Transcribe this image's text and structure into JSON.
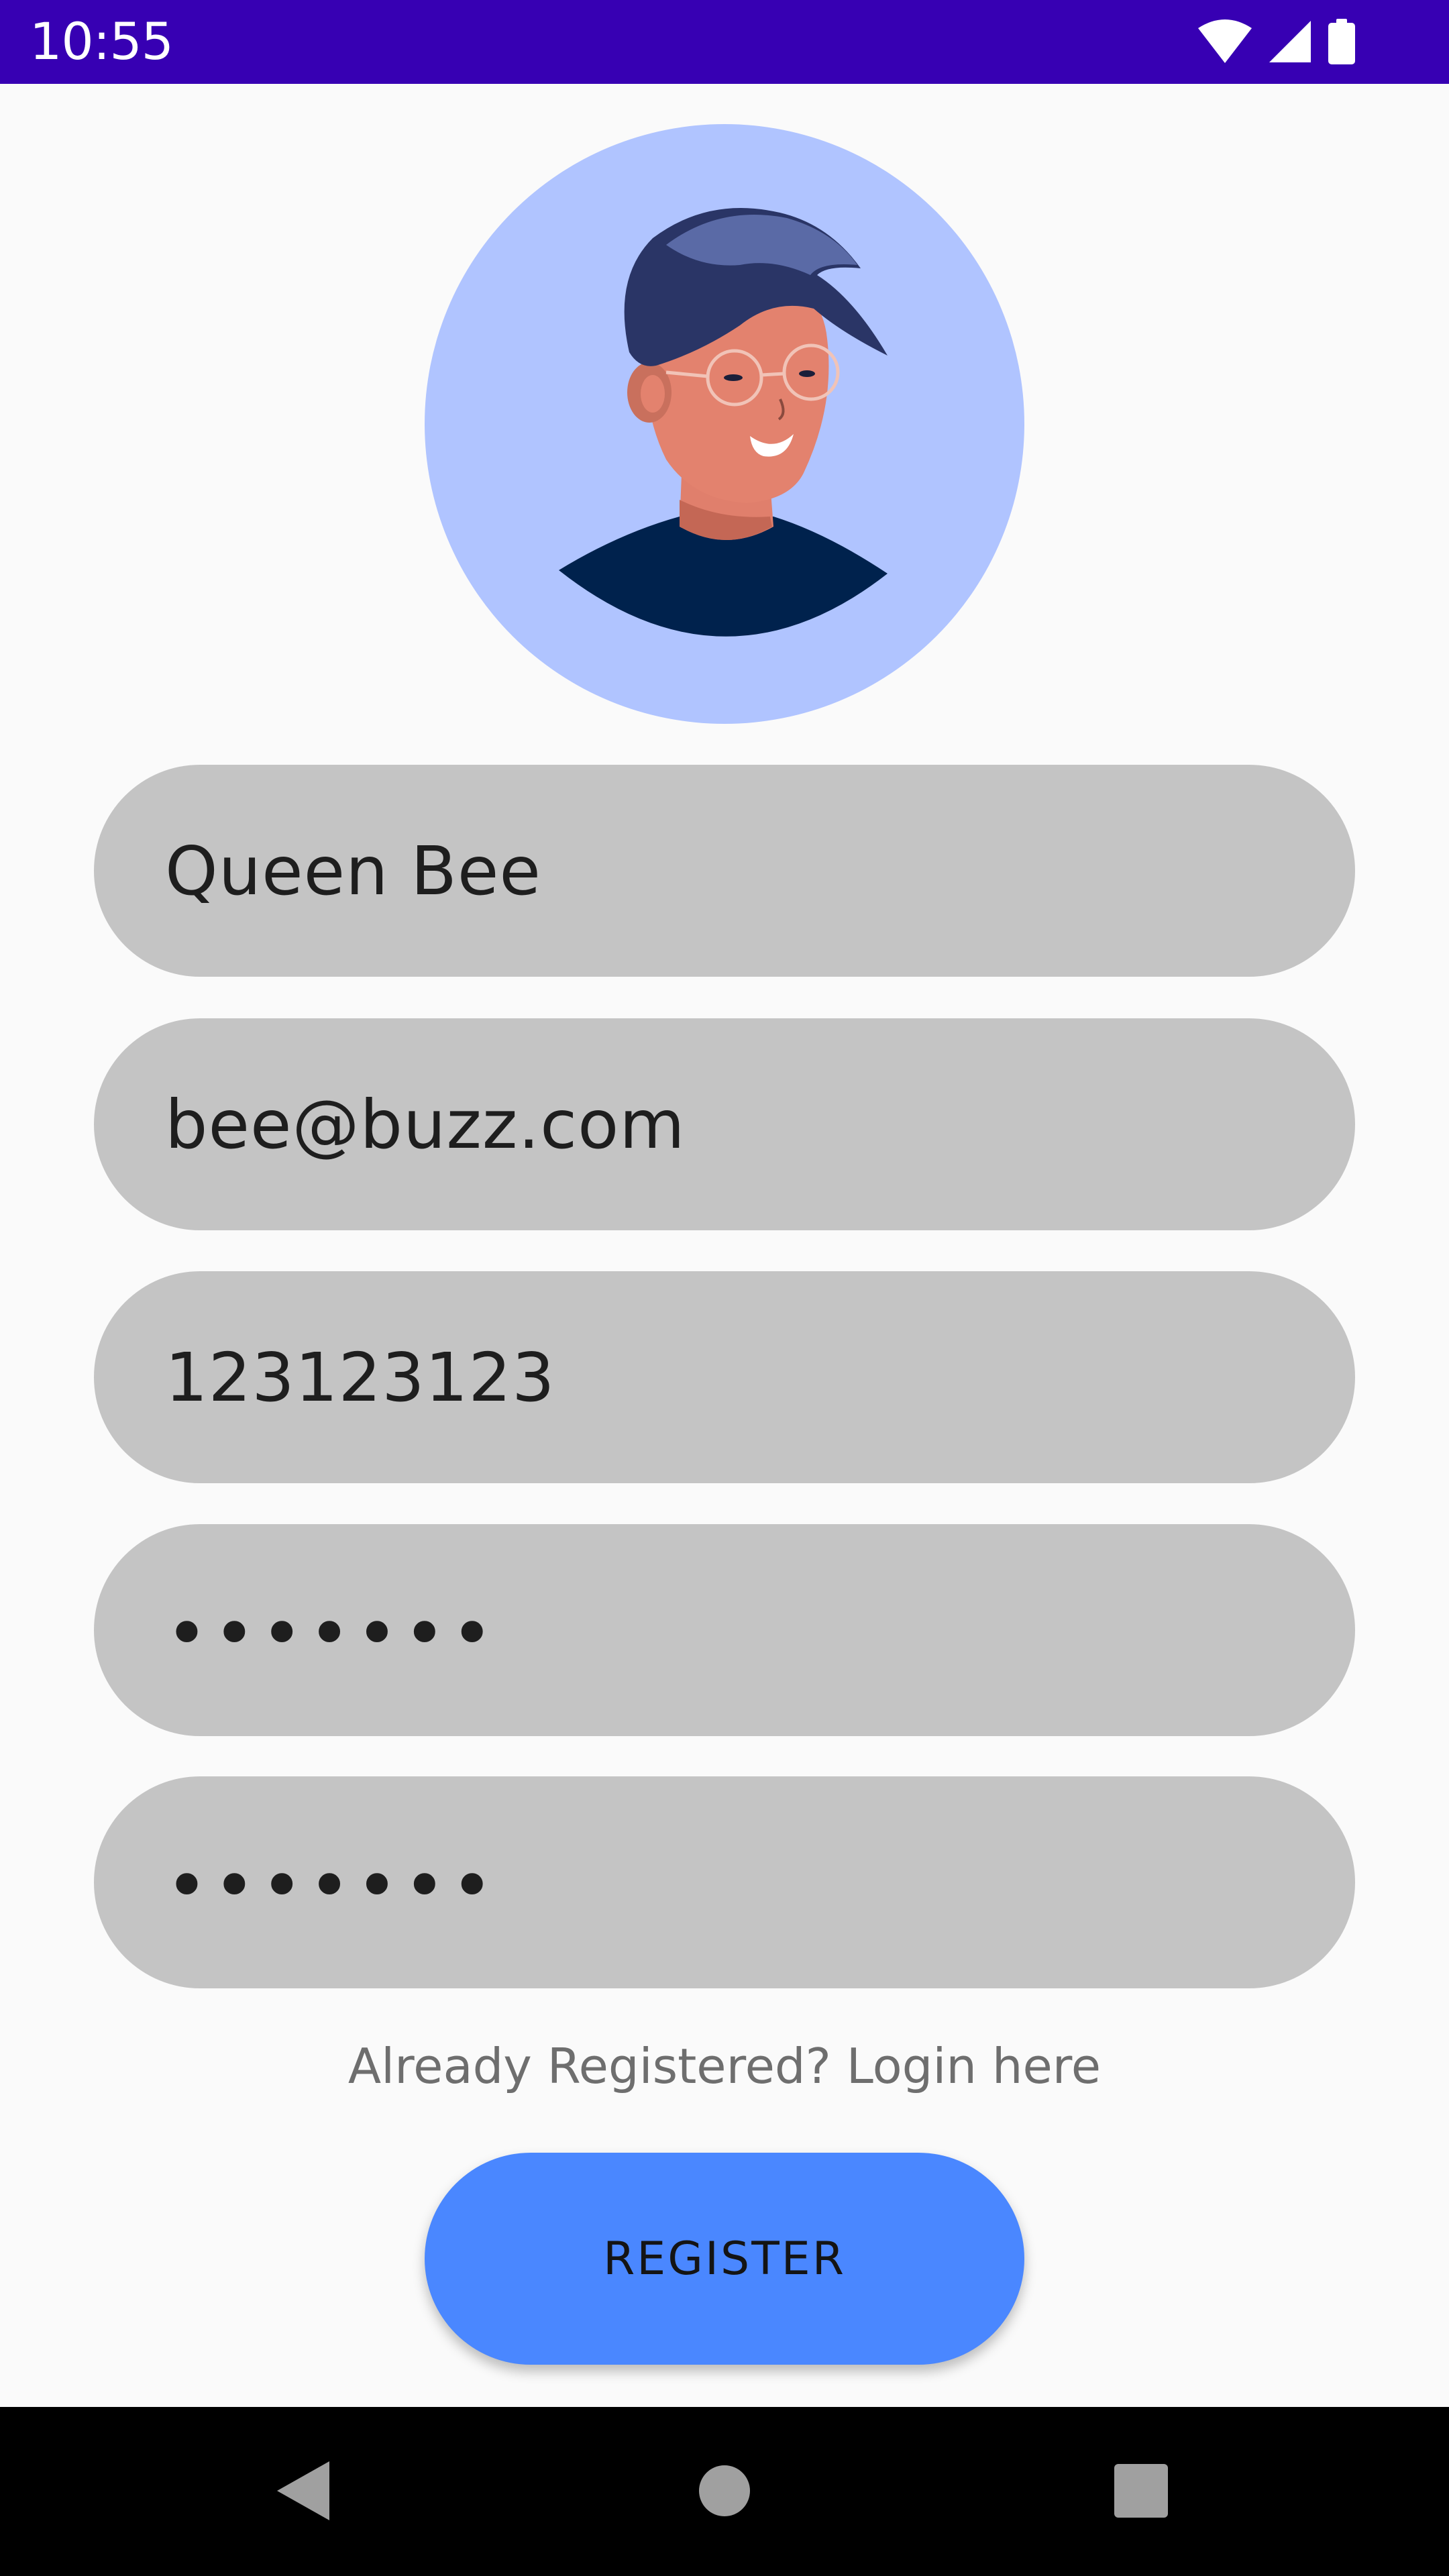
{
  "status_bar": {
    "time": "10:55",
    "icons": [
      "wifi-icon",
      "cellular-signal-icon",
      "battery-icon"
    ],
    "background": "#3700b3"
  },
  "avatar": {
    "icon": "user-avatar-illustration",
    "background": "#b0c4ff"
  },
  "form": {
    "name_value": "Queen Bee",
    "email_value": "bee@buzz.com",
    "phone_value": "123123123",
    "password_value": "•••••••",
    "confirm_password_value": "•••••••",
    "field_color": "#c4c4c4"
  },
  "login_link": "Already Registered? Login here",
  "register_button": {
    "label": "REGISTER",
    "color": "#4a87ff"
  },
  "nav_bar": {
    "icons": [
      "back-icon",
      "home-icon",
      "recents-icon"
    ]
  }
}
